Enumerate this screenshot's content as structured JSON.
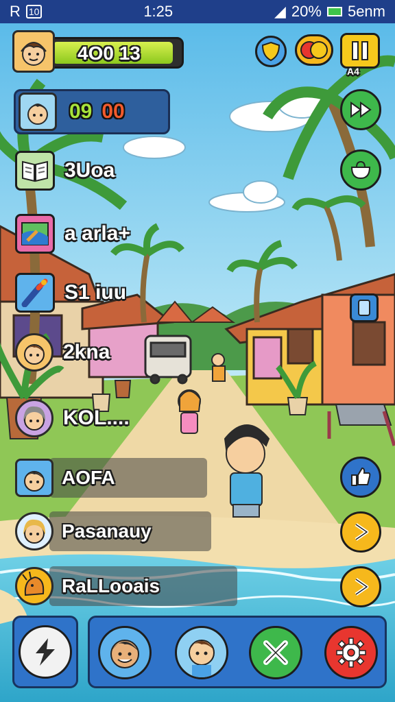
{
  "status_bar": {
    "carrier": "R",
    "badge": "10",
    "time": "1:25",
    "battery": "20%",
    "network": "5enm"
  },
  "player": {
    "xp_text": "4O0 13",
    "xp_progress": 0.95
  },
  "timer": {
    "green_value": "09",
    "red_value": "00"
  },
  "menu": {
    "items": [
      {
        "label": "3Uoa",
        "icon": "book-icon"
      },
      {
        "label": "a arla+",
        "icon": "map-icon"
      },
      {
        "label": "S1 iuu",
        "icon": "tool-icon"
      },
      {
        "label": "2kna",
        "icon": "avatar-icon"
      },
      {
        "label": "KOL....",
        "icon": "avatar-icon"
      }
    ]
  },
  "list": {
    "rows": [
      {
        "label": "AOFA"
      },
      {
        "label": "Pasanauy"
      },
      {
        "label": "RaLLooais"
      }
    ]
  },
  "top_right": {
    "level_label": "A4"
  },
  "icons": {
    "shield": "shield-icon",
    "coins": "coins-icon",
    "pause": "pause-icon",
    "fast_forward": "fast-forward-icon",
    "bag": "bag-icon",
    "phone": "phone-icon",
    "like": "thumbs-up-icon",
    "play": "play-icon",
    "lightning": "lightning-icon",
    "cancel": "cancel-icon",
    "settings": "gear-icon"
  },
  "colors": {
    "accent_blue": "#2f73c9",
    "xp_green": "#8cc81e",
    "timer_red": "#f25a2c",
    "play_yellow": "#f6b81c",
    "cancel_green": "#3eb84b",
    "settings_red": "#e8362f"
  }
}
